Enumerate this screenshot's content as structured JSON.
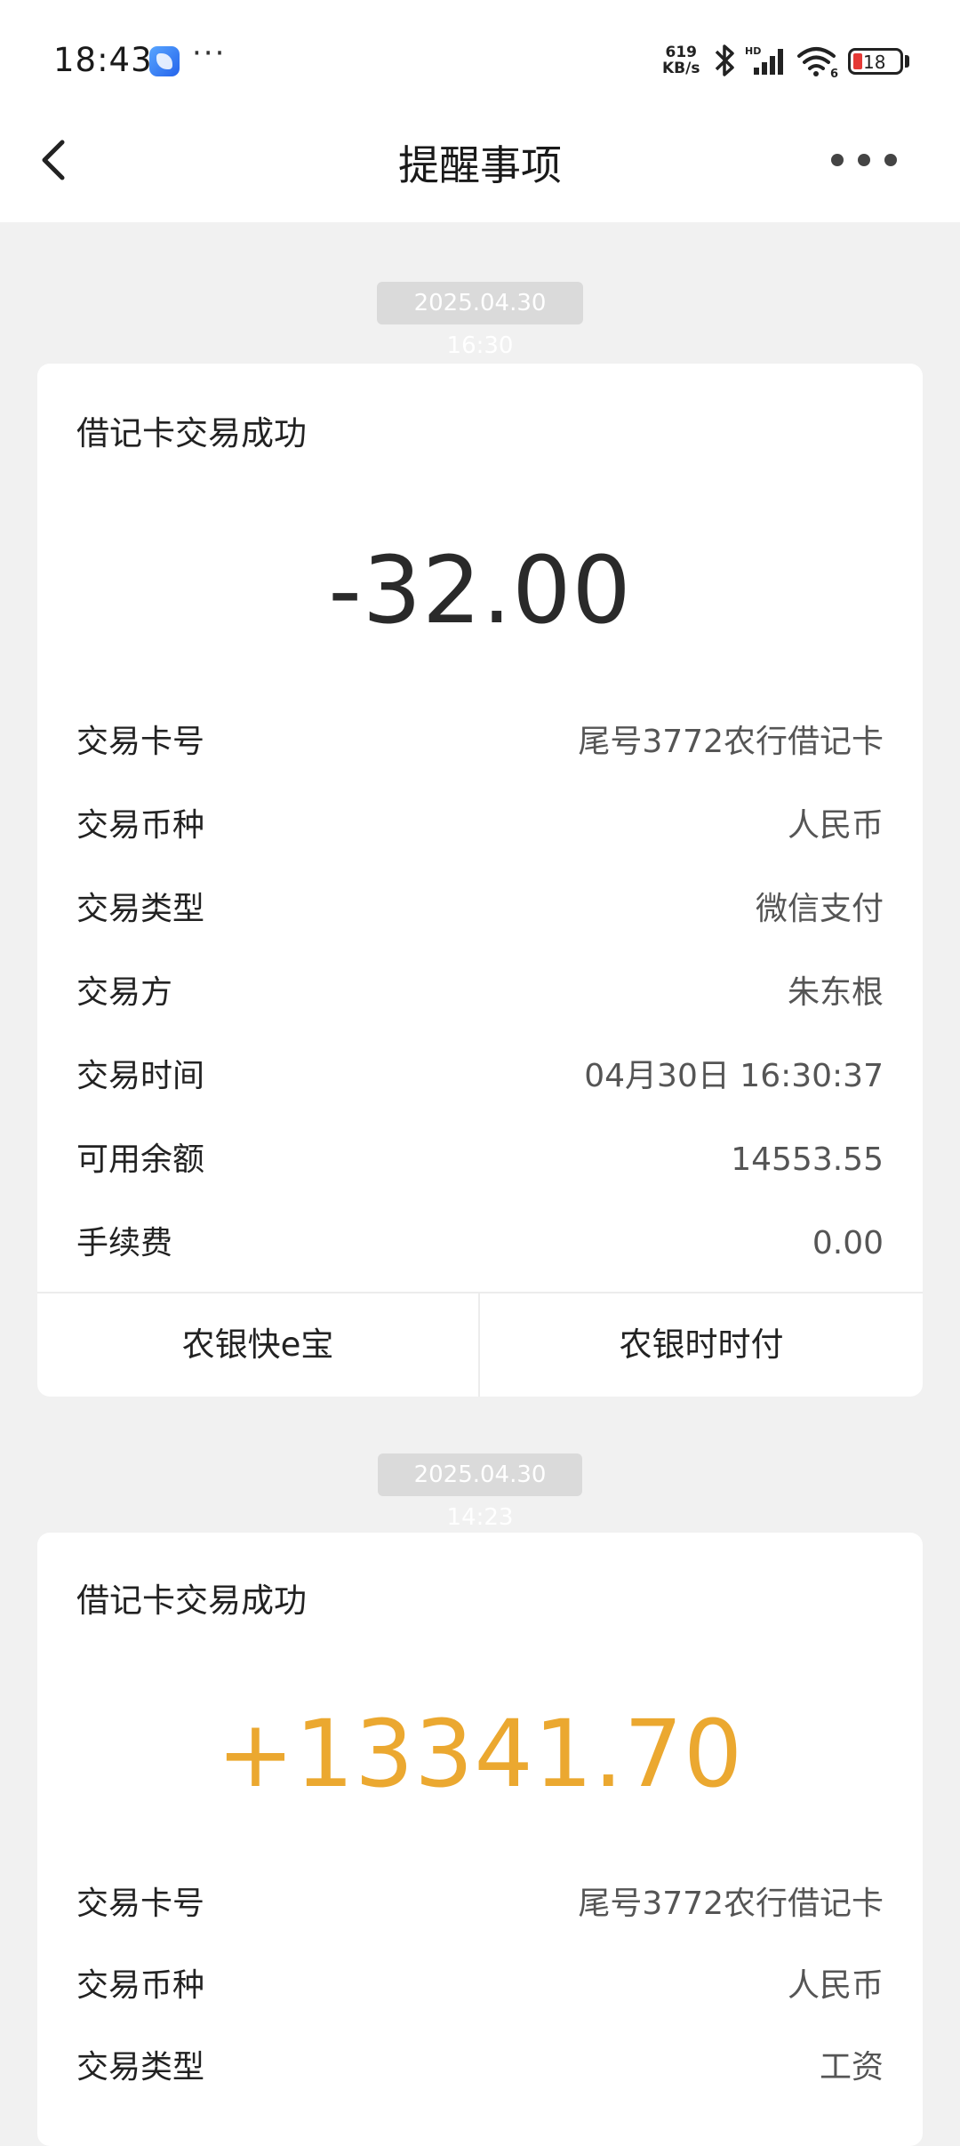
{
  "status_bar": {
    "time": "18:43",
    "more": "···",
    "net_speed_value": "619",
    "net_speed_unit": "KB/s",
    "signal_label": "HD",
    "wifi_label": "6",
    "battery_level": "18",
    "battery_color": "#e53935"
  },
  "header": {
    "title": "提醒事项",
    "back_icon": "chevron-left-icon",
    "more_icon": "more-horizontal-icon"
  },
  "messages": [
    {
      "timestamp": "2025.04.30 16:30",
      "title": "借记卡交易成功",
      "amount": "-32.00",
      "amount_color": "#2a2a2a",
      "rows": [
        {
          "label": "交易卡号",
          "value": "尾号3772农行借记卡"
        },
        {
          "label": "交易币种",
          "value": "人民币"
        },
        {
          "label": "交易类型",
          "value": "微信支付"
        },
        {
          "label": "交易方",
          "value": "朱东根"
        },
        {
          "label": "交易时间",
          "value": "04月30日 16:30:37"
        },
        {
          "label": "可用余额",
          "value": "14553.55"
        },
        {
          "label": "手续费",
          "value": "0.00"
        }
      ],
      "actions": [
        "农银快e宝",
        "农银时时付"
      ]
    },
    {
      "timestamp": "2025.04.30 14:23",
      "title": "借记卡交易成功",
      "amount": "+13341.70",
      "amount_color": "#eba830",
      "rows": [
        {
          "label": "交易卡号",
          "value": "尾号3772农行借记卡"
        },
        {
          "label": "交易币种",
          "value": "人民币"
        },
        {
          "label": "交易类型",
          "value": "工资"
        }
      ]
    }
  ]
}
